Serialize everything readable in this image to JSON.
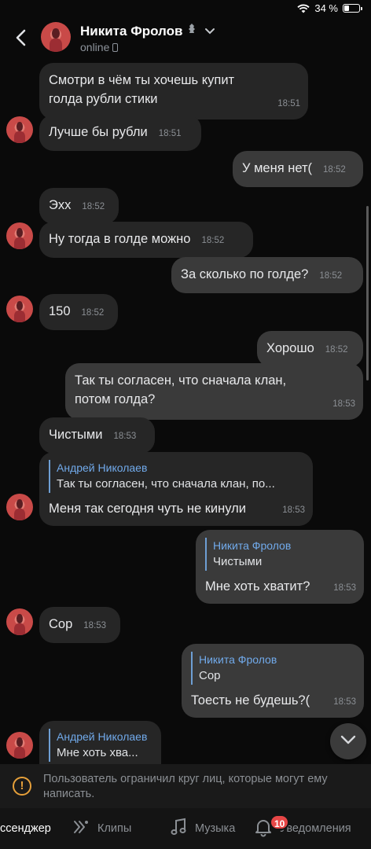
{
  "status_bar": {
    "battery": "34 %",
    "battery_level": 0.34
  },
  "header": {
    "contact_name": "Никита Фролов",
    "status": "online"
  },
  "messages": [
    {
      "dir": "in",
      "text": "Смотри в чём ты хочешь купит голда рубли стики",
      "time": "18:51"
    },
    {
      "dir": "in",
      "text": "Лучше бы рубли",
      "time": "18:51"
    },
    {
      "dir": "out",
      "text": "У меня нет(",
      "time": "18:52"
    },
    {
      "dir": "in",
      "text": "Эхх",
      "time": "18:52"
    },
    {
      "dir": "in",
      "text": "Ну тогда в голде можно",
      "time": "18:52"
    },
    {
      "dir": "out",
      "text": "За сколько по голде?",
      "time": "18:52"
    },
    {
      "dir": "in",
      "text": "150",
      "time": "18:52"
    },
    {
      "dir": "out",
      "text": "Хорошо",
      "time": "18:52"
    },
    {
      "dir": "out",
      "text": "Так ты согласен, что сначала клан, потом голда?",
      "time": "18:53"
    },
    {
      "dir": "in",
      "text": "Чистыми",
      "time": "18:53"
    },
    {
      "dir": "in",
      "reply_author": "Андрей Николаев",
      "reply_text": "Так ты согласен, что сначала клан, по...",
      "text": "Меня так сегодня чуть не кинули",
      "time": "18:53"
    },
    {
      "dir": "out",
      "reply_author": "Никита Фролов",
      "reply_text": "Чистыми",
      "text": "Мне хоть хватит?",
      "time": "18:53"
    },
    {
      "dir": "in",
      "text": "Сор",
      "time": "18:53"
    },
    {
      "dir": "out",
      "reply_author": "Никита Фролов",
      "reply_text": "Сор",
      "text": "Тоесть не будешь?(",
      "time": "18:53"
    },
    {
      "dir": "in",
      "reply_author": "Андрей Николаев",
      "reply_text": "Мне хоть хва...",
      "text": "",
      "time": ""
    }
  ],
  "restriction_notice": "Пользователь ограничил круг лиц, которые могут ему написать.",
  "tabbar": {
    "messenger": "ссенджер",
    "clips": "Клипы",
    "music": "Музыка",
    "notifications": "Уведомления",
    "notifications_badge": "10"
  },
  "icons": {
    "back": "back-arrow-icon",
    "chevron": "chevron-down-icon",
    "verified": "badge-icon",
    "warning": "warning-icon",
    "scroll_down": "chevron-down-icon",
    "clips": "clips-icon",
    "music": "music-note-icon",
    "bell": "bell-icon"
  },
  "colors": {
    "background": "#0a0a0a",
    "incoming_bubble": "#262626",
    "outgoing_bubble": "#3a3a3a",
    "reply_author": "#71aaeb",
    "badge": "#e64646",
    "warning": "#e6a03a"
  }
}
